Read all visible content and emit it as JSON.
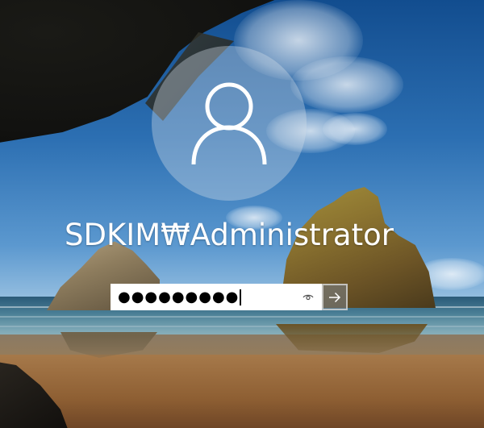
{
  "login": {
    "username": "SDKIM₩Administrator",
    "password_mask": "●●●●●●●●●"
  },
  "icons": {
    "avatar": "user-silhouette-icon",
    "reveal": "eye-icon",
    "submit": "arrow-right-icon"
  },
  "colors": {
    "text": "#ffffff",
    "field_bg": "#ffffff",
    "avatar_bg": "rgba(210,220,232,0.38)"
  }
}
